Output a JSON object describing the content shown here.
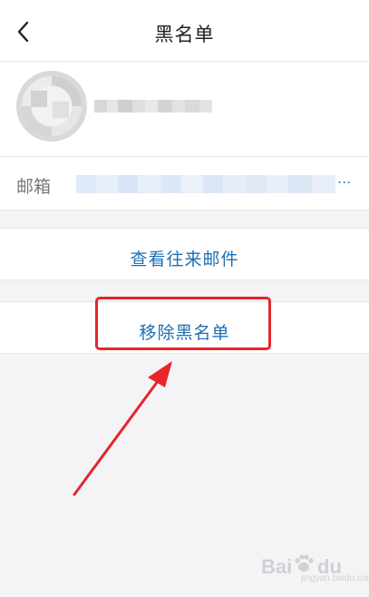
{
  "navbar": {
    "title": "黑名单",
    "back_icon": "chevron-left-icon"
  },
  "contact": {
    "email_label": "邮箱",
    "email_ellipsis": "..."
  },
  "actions": {
    "view_mail_label": "查看往来邮件",
    "remove_label": "移除黑名单"
  },
  "annotation": {
    "highlight_color": "#e5262b",
    "arrow_color": "#e5262b"
  },
  "watermark": {
    "brand": "Bai",
    "brand_tail": "du",
    "sub": "jingyan.baidu.com"
  },
  "colors": {
    "accent": "#1f6fb2",
    "background": "#f4f4f6"
  }
}
